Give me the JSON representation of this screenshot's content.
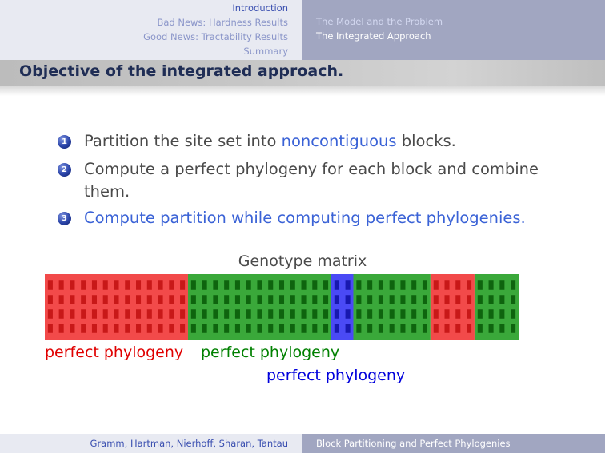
{
  "header": {
    "sections": [
      "Introduction",
      "Bad News: Hardness Results",
      "Good News: Tractability Results",
      "Summary"
    ],
    "subsections": [
      "The Model and the Problem",
      "The Integrated Approach"
    ]
  },
  "slide": {
    "title": "Objective of the integrated approach.",
    "items": [
      {
        "number": "1",
        "before": "Partition the site set into ",
        "highlight": "noncontiguous",
        "after": " blocks."
      },
      {
        "number": "2",
        "line1": "Compute a perfect phylogeny for each block and combine",
        "line2": "them."
      },
      {
        "number": "3",
        "text": "Compute partition while computing perfect phylogenies."
      }
    ]
  },
  "figure": {
    "title": "Genotype matrix",
    "rows": 4,
    "blocks": [
      {
        "color": "red",
        "columns": 13
      },
      {
        "color": "green",
        "columns": 13
      },
      {
        "color": "blue",
        "columns": 2
      },
      {
        "color": "green",
        "columns": 7
      },
      {
        "color": "red",
        "columns": 4
      },
      {
        "color": "green",
        "columns": 4
      }
    ],
    "labels": [
      {
        "text": "perfect phylogeny",
        "color": "red"
      },
      {
        "text": "perfect phylogeny",
        "color": "green"
      },
      {
        "text": "perfect phylogeny",
        "color": "blue"
      }
    ],
    "colors": {
      "red": "#f24a4a",
      "red_cell": "#c81818",
      "green": "#3aa83a",
      "green_cell": "#0e640e",
      "blue": "#4a4af5",
      "blue_cell": "#1818b0",
      "red_text": "#e00000",
      "green_text": "#008000",
      "blue_text": "#0000dc"
    }
  },
  "footer": {
    "authors": "Gramm, Hartman, Nierhoff, Sharan, Tantau",
    "talk_title": "Block Partitioning and Perfect Phylogenies"
  }
}
